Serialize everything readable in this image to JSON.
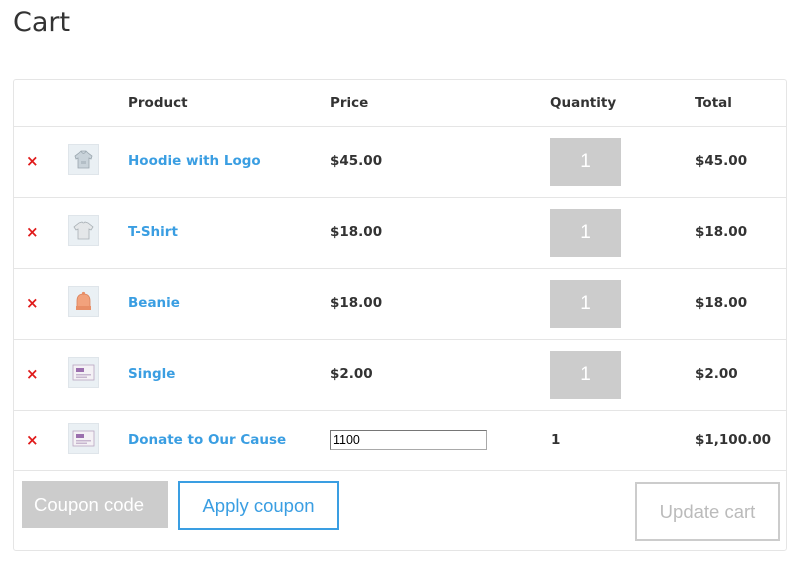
{
  "page": {
    "title": "Cart"
  },
  "table": {
    "headers": {
      "product": "Product",
      "price": "Price",
      "quantity": "Quantity",
      "total": "Total"
    },
    "rows": [
      {
        "remove": "×",
        "thumb_icon": "hoodie-icon",
        "name": "Hoodie with Logo",
        "price": "$45.00",
        "quantity": "1",
        "total": "$45.00"
      },
      {
        "remove": "×",
        "thumb_icon": "tshirt-icon",
        "name": "T-Shirt",
        "price": "$18.00",
        "quantity": "1",
        "total": "$18.00"
      },
      {
        "remove": "×",
        "thumb_icon": "beanie-icon",
        "name": "Beanie",
        "price": "$18.00",
        "quantity": "1",
        "total": "$18.00"
      },
      {
        "remove": "×",
        "thumb_icon": "album-icon",
        "name": "Single",
        "price": "$2.00",
        "quantity": "1",
        "total": "$2.00"
      },
      {
        "remove": "×",
        "thumb_icon": "album-icon",
        "name": "Donate to Our Cause",
        "amount_value": "1100",
        "quantity": "1",
        "total": "$1,100.00"
      }
    ]
  },
  "actions": {
    "coupon_placeholder": "Coupon code",
    "apply_coupon_label": "Apply coupon",
    "update_cart_label": "Update cart"
  },
  "colors": {
    "link": "#3a9ee2",
    "remove": "#e01b1b",
    "input_fill": "#cccccc",
    "border": "#e5e5e5"
  }
}
